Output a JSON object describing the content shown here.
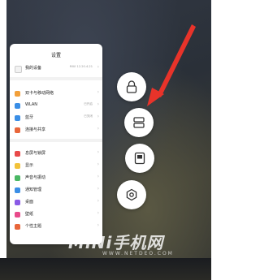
{
  "settings": {
    "title": "设置",
    "device": {
      "label": "我的设备",
      "value": "MIUI 12.20.4.21"
    },
    "group1": [
      {
        "label": "双卡与移动网络",
        "value": "",
        "icon": "sim-icon",
        "color": "#f2a03a"
      },
      {
        "label": "WLAN",
        "value": "已开启",
        "icon": "wifi-icon",
        "color": "#3a8ee6"
      },
      {
        "label": "蓝牙",
        "value": "已关闭",
        "icon": "bluetooth-icon",
        "color": "#3a8ee6"
      },
      {
        "label": "连接与共享",
        "value": "",
        "icon": "share-icon",
        "color": "#e8663a"
      }
    ],
    "group2": [
      {
        "label": "息屏与锁屏",
        "value": "",
        "icon": "lock-screen-icon",
        "color": "#e84a4a"
      },
      {
        "label": "显示",
        "value": "",
        "icon": "display-icon",
        "color": "#f2c23a"
      },
      {
        "label": "声音与振动",
        "value": "",
        "icon": "sound-icon",
        "color": "#4ab864"
      },
      {
        "label": "通知管理",
        "value": "",
        "icon": "notification-icon",
        "color": "#3a8ee6"
      },
      {
        "label": "桌面",
        "value": "",
        "icon": "home-icon",
        "color": "#8a5ae6"
      },
      {
        "label": "壁纸",
        "value": "",
        "icon": "wallpaper-icon",
        "color": "#e84a8a"
      },
      {
        "label": "个性主题",
        "value": "",
        "icon": "theme-icon",
        "color": "#e8663a"
      }
    ]
  },
  "actions": [
    {
      "name": "lock-app-button",
      "icon": "lock-icon"
    },
    {
      "name": "split-screen-button",
      "icon": "split-screen-icon"
    },
    {
      "name": "small-window-button",
      "icon": "floating-window-icon"
    },
    {
      "name": "app-settings-button",
      "icon": "hexagon-settings-icon"
    }
  ],
  "arrow_color": "#e8332a",
  "watermark": {
    "title": "MiNi手机网",
    "url": "WWW.NETDEO.COM"
  }
}
